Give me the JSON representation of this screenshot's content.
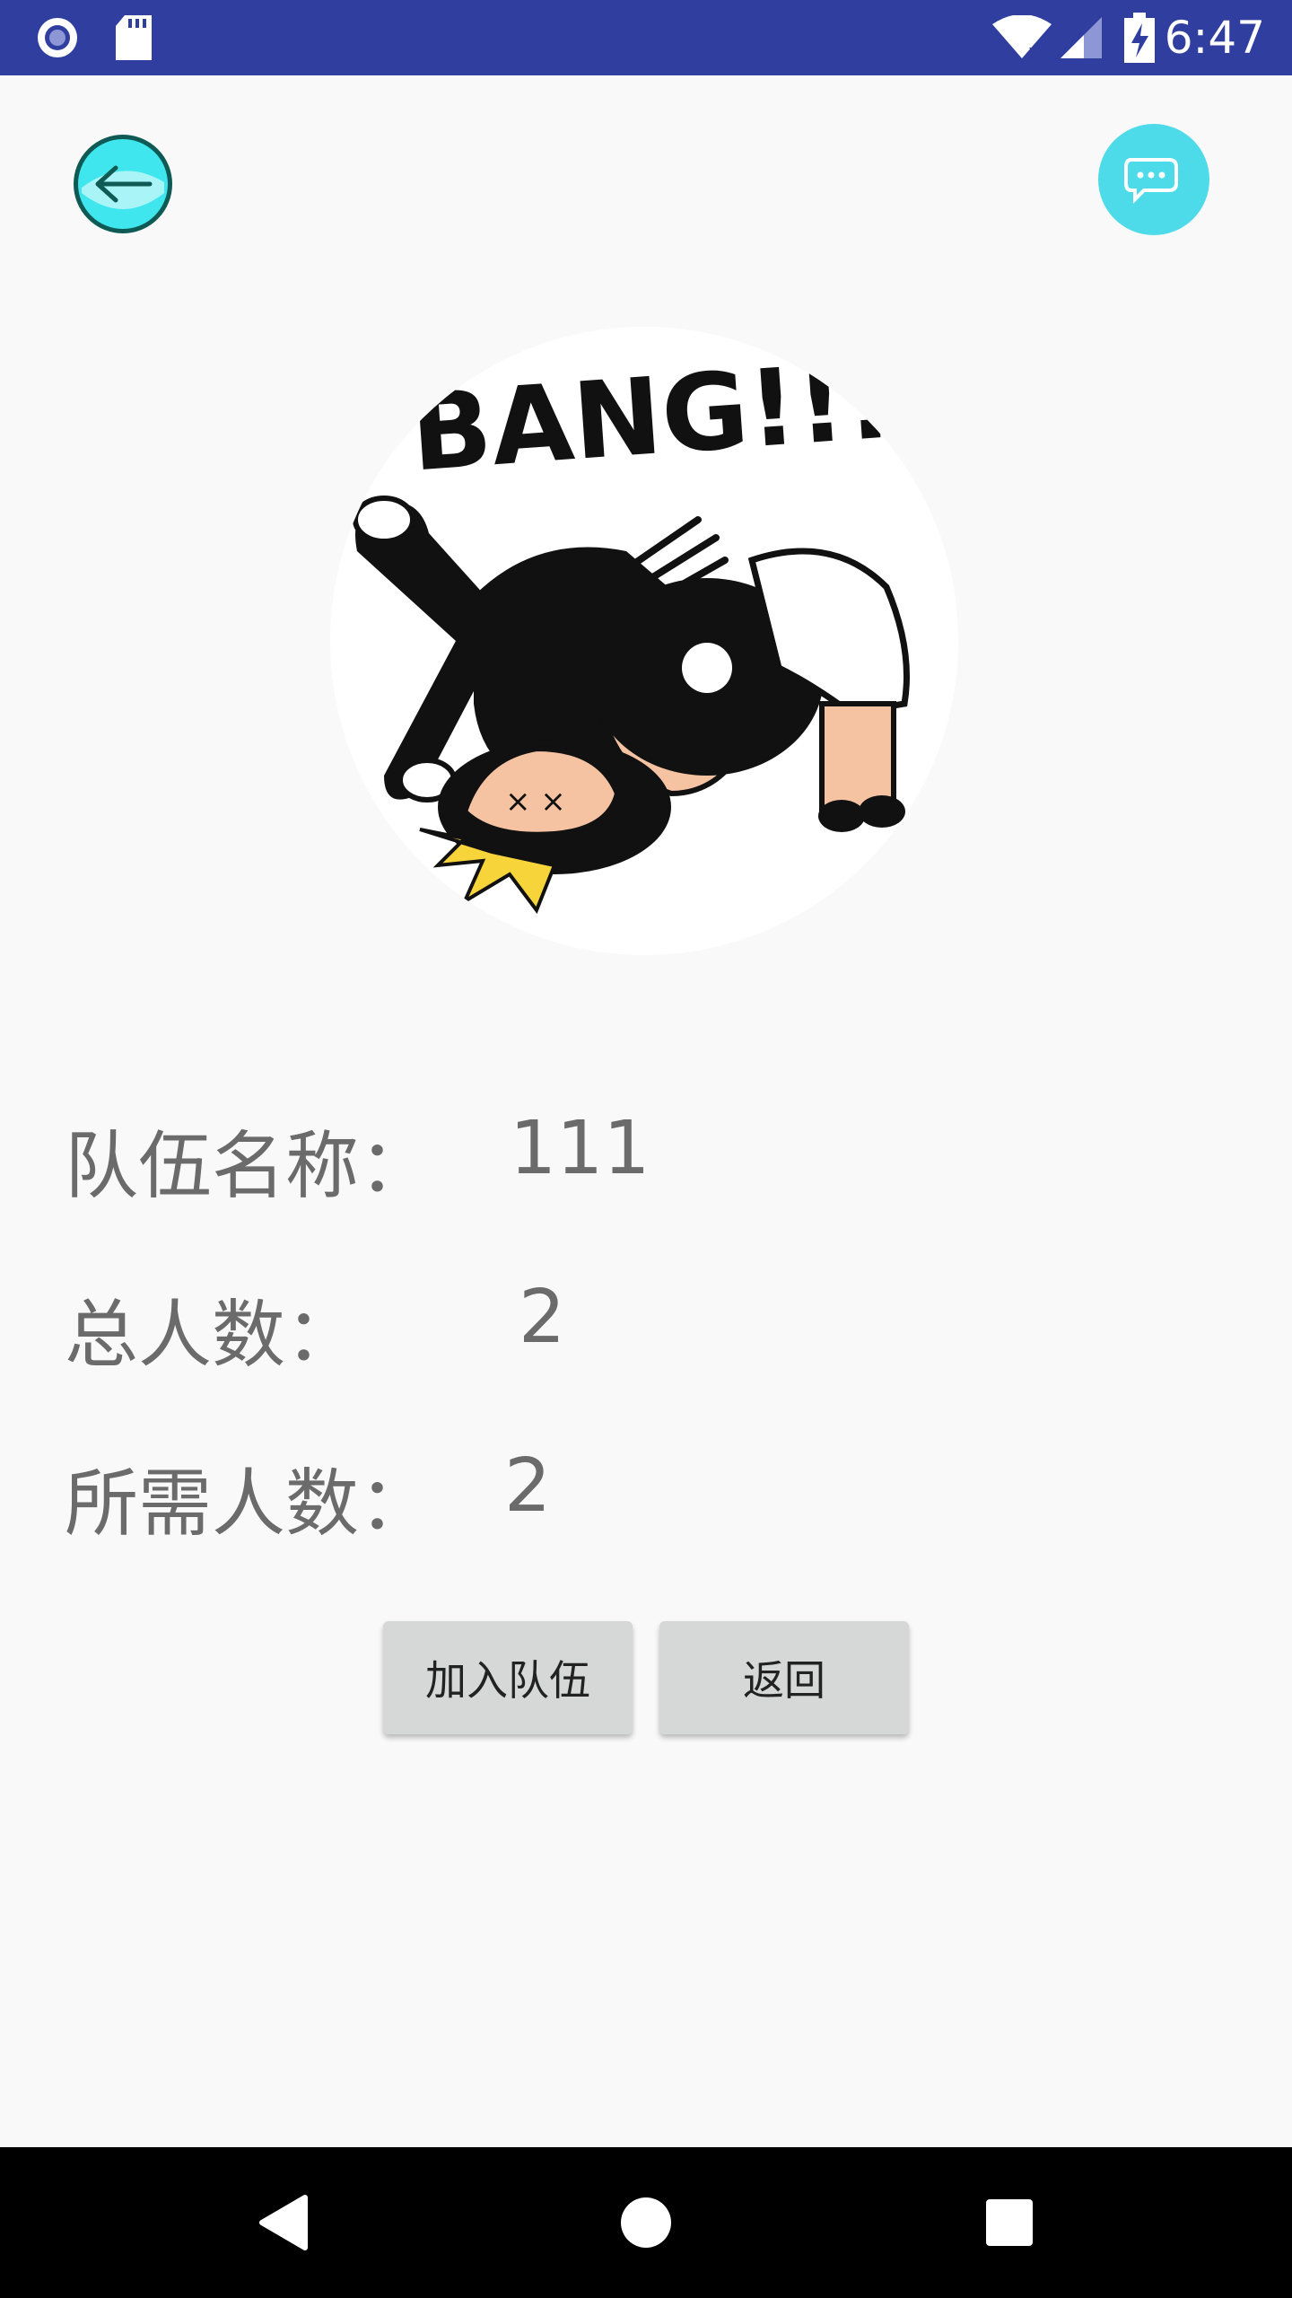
{
  "status_bar": {
    "time": "6:47",
    "icons": [
      "record-icon",
      "sd-card-icon",
      "wifi-icon",
      "signal-icon",
      "battery-charging-icon"
    ]
  },
  "top_bar": {
    "back_icon": "back-arrow-icon",
    "chat_icon": "chat-bubble-icon"
  },
  "team_avatar": {
    "caption_text": "BANG!!!"
  },
  "team_info": {
    "name_label": "队伍名称：",
    "name_value": "111",
    "total_label": "总人数：",
    "total_value": "2",
    "needed_label": "所需人数：",
    "needed_value": "2"
  },
  "actions": {
    "join_label": "加入队伍",
    "return_label": "返回"
  },
  "nav_bar": {
    "back": "nav-back-icon",
    "home": "nav-home-icon",
    "recents": "nav-recents-icon"
  },
  "colors": {
    "status_bar": "#303f9f",
    "accent_cyan": "#4ddbe9",
    "button_bg": "#d6d7d7",
    "text_gray": "#6b6b6b"
  }
}
